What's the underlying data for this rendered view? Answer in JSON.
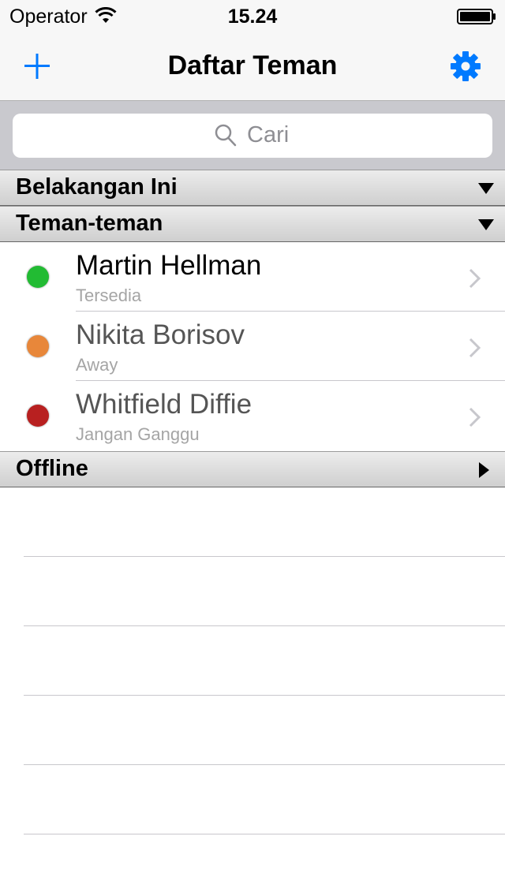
{
  "status_bar": {
    "carrier": "Operator",
    "time": "15.24"
  },
  "nav": {
    "title": "Daftar Teman",
    "add_icon": "plus-icon",
    "settings_icon": "gear-icon",
    "accent_color": "#007aff"
  },
  "search": {
    "placeholder": "Cari"
  },
  "sections": [
    {
      "title": "Belakangan Ini",
      "expanded": true
    },
    {
      "title": "Teman-teman",
      "expanded": true
    },
    {
      "title": "Offline",
      "expanded": false
    }
  ],
  "contacts": [
    {
      "name": "Martin Hellman",
      "status": "Tersedia",
      "status_color": "#22bb33"
    },
    {
      "name": "Nikita Borisov",
      "status": "Away",
      "status_color": "#e8873a"
    },
    {
      "name": "Whitfield Diffie",
      "status": "Jangan Ganggu",
      "status_color": "#b82020"
    }
  ]
}
